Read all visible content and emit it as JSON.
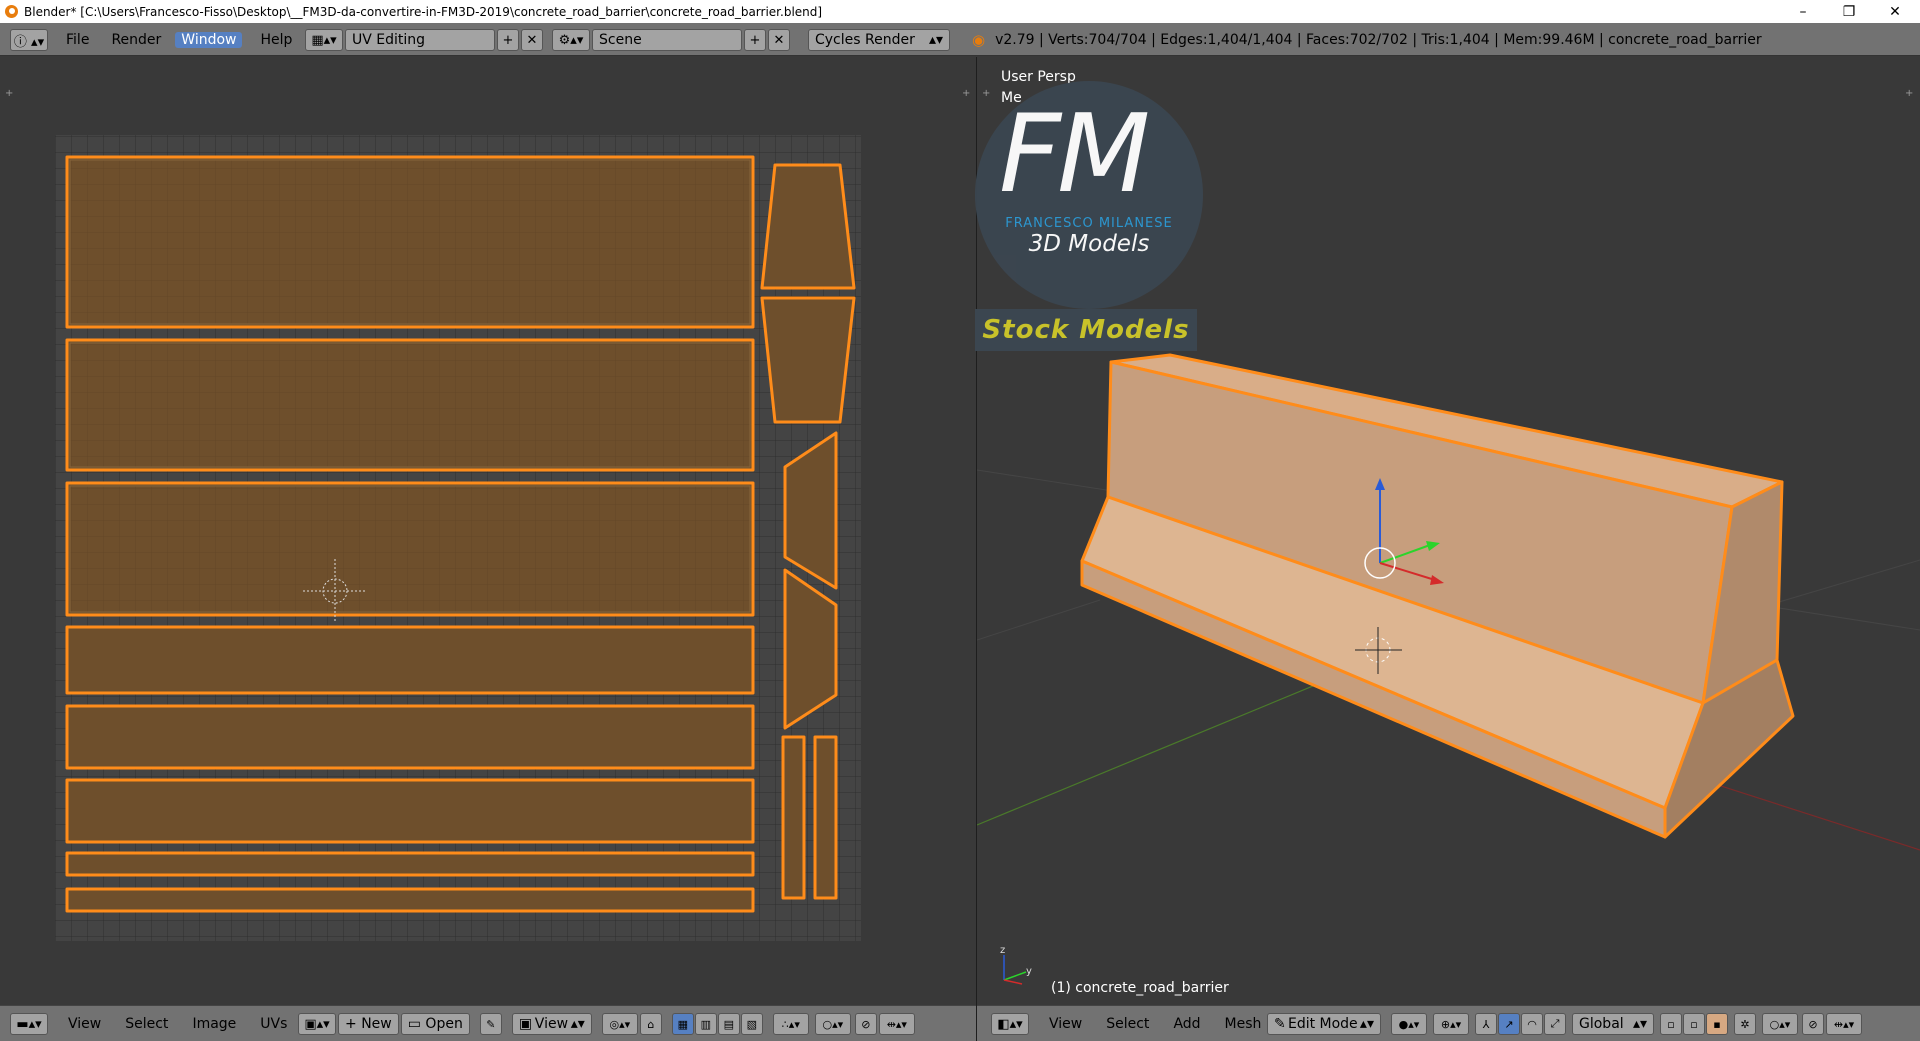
{
  "window": {
    "title": "Blender* [C:\\Users\\Francesco-Fisso\\Desktop\\__FM3D-da-convertire-in-FM3D-2019\\concrete_road_barrier\\concrete_road_barrier.blend]",
    "minimize": "–",
    "maximize": "❐",
    "close": "✕"
  },
  "info_header": {
    "menus": [
      "File",
      "Render",
      "Window",
      "Help"
    ],
    "active_menu": "Window",
    "screen_layout": "UV Editing",
    "scene": "Scene",
    "render_engine": "Cycles Render",
    "stats": "v2.79 | Verts:704/704 | Edges:1,404/1,404 | Faces:702/702 | Tris:1,404 | Mem:99.46M | concrete_road_barrier"
  },
  "viewport": {
    "view_label": "User Persp",
    "mode_label": "Me",
    "object_label": "(1) concrete_road_barrier"
  },
  "watermark": {
    "logo_letters": "FM",
    "brand_name": "FRANCESCO MILANESE",
    "brand_sub": "3D Models",
    "banner": "Stock Models"
  },
  "uv_footer": {
    "menus": [
      "View",
      "Select",
      "Image",
      "UVs"
    ],
    "new_label": "New",
    "open_label": "Open",
    "view_label": "View"
  },
  "v3d_footer": {
    "menus": [
      "View",
      "Select",
      "Add",
      "Mesh"
    ],
    "mode": "Edit Mode",
    "orientation": "Global"
  },
  "colors": {
    "accent_orange": "#ff8c1a",
    "uv_fill": "#6e4f2c",
    "mesh_fill": "#d6a882",
    "active_menu_blue": "#5680c2",
    "logo_blue": "#2c9ad6",
    "banner_yellow": "#c8c22a"
  }
}
